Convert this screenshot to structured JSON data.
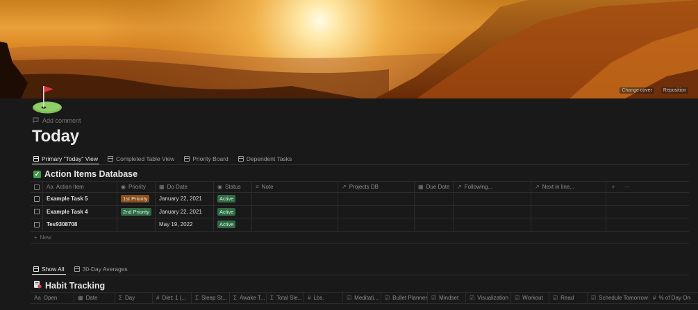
{
  "cover": {
    "change_cover": "Change cover",
    "reposition": "Reposition"
  },
  "page": {
    "add_comment": "Add comment",
    "title": "Today"
  },
  "views": [
    {
      "label": "Primary \"Today\" View",
      "active": true
    },
    {
      "label": "Completed Table View",
      "active": false
    },
    {
      "label": "Priority Board",
      "active": false
    },
    {
      "label": "Dependent Tasks",
      "active": false
    }
  ],
  "action_db": {
    "title": "Action Items Database",
    "columns": {
      "action_item": "Action Item",
      "priority": "Priority",
      "do_date": "Do Date",
      "status": "Status",
      "note": "Note",
      "projects_db": "Projects DB",
      "due_date": "Due Date",
      "following": "Following...",
      "next_in_line": "Next in line..."
    },
    "rows": [
      {
        "name": "Example Task 5",
        "priority": "1st Priority",
        "do_date": "January 22, 2021",
        "status": "Active"
      },
      {
        "name": "Example Task 4",
        "priority": "2nd Priority",
        "do_date": "January 22, 2021",
        "status": "Active"
      },
      {
        "name": "Tes9308708",
        "priority": "",
        "do_date": "May 19, 2022",
        "status": "Active"
      }
    ],
    "new_label": "New"
  },
  "views2": [
    {
      "label": "Show All",
      "active": true
    },
    {
      "label": "30-Day Averages",
      "active": false
    }
  ],
  "habit_db": {
    "title": "Habit Tracking",
    "columns": {
      "open": "Open",
      "date": "Date",
      "day": "Day",
      "diet": "Diet: 1 (...",
      "sleep_st": "Sleep St...",
      "awake_t": "Awake T...",
      "total_sle": "Total Sle...",
      "lbs": "Lbs.",
      "meditati": "Meditati...",
      "bullet_planner": "Bullet Planner",
      "mindset": "Mindset",
      "visualization": "Visualization",
      "workout": "Workout",
      "read": "Read",
      "schedule_tomorrow": "Schedule Tomorrow",
      "pct_day": "% of Day On-S"
    }
  },
  "colors": {
    "background": "#191919",
    "tag_orange": "#8a4f1c",
    "tag_green": "#2f6b45"
  }
}
